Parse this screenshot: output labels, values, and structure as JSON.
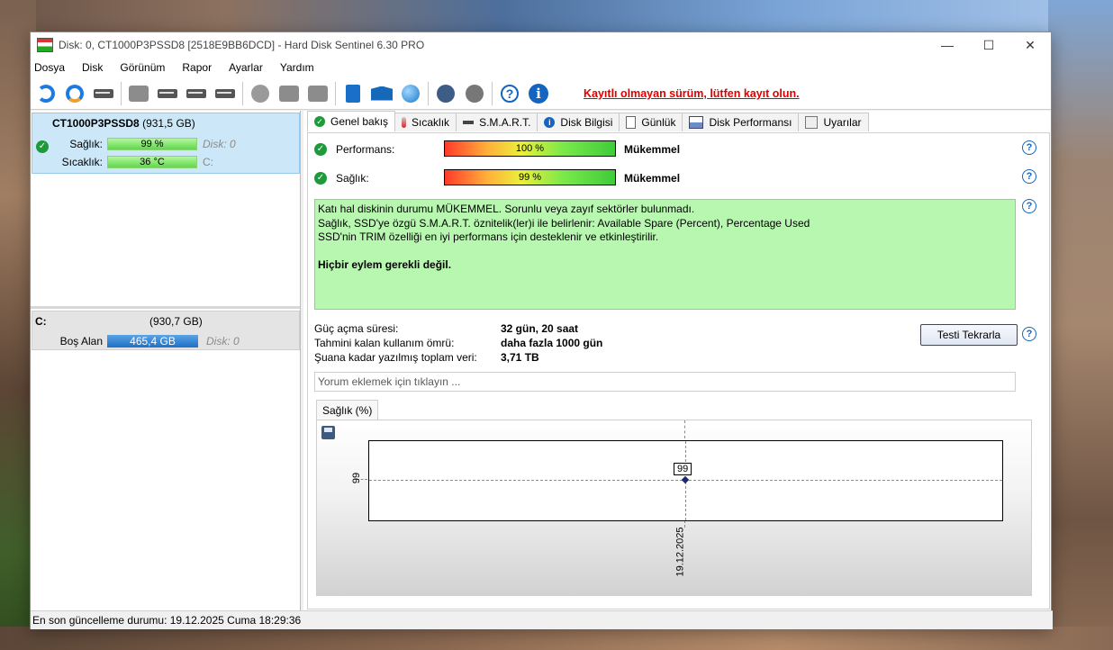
{
  "window": {
    "title": "Disk: 0, CT1000P3PSSD8 [2518E9BB6DCD]  -  Hard Disk Sentinel 6.30 PRO",
    "minimize": "—",
    "maximize": "☐",
    "close": "✕"
  },
  "menu": [
    {
      "label": "Dosya"
    },
    {
      "label": "Disk"
    },
    {
      "label": "Görünüm"
    },
    {
      "label": "Rapor"
    },
    {
      "label": "Ayarlar"
    },
    {
      "label": "Yardım"
    }
  ],
  "toolbar": {
    "nag": "Kayıtlı olmayan sürüm, lütfen kayıt olun.",
    "help": "?",
    "info": "i"
  },
  "disk_card": {
    "name": "CT1000P3PSSD8",
    "size": "(931,5 GB)",
    "health_label": "Sağlık:",
    "health_value": "99 %",
    "health_fraction": 0.99,
    "disk_index": "Disk: 0",
    "temp_label": "Sıcaklık:",
    "temp_value": "36 °C",
    "drive": "C:"
  },
  "volume": {
    "letter": "C:",
    "size": "(930,7 GB)",
    "free_label": "Boş Alan",
    "free_value": "465,4 GB",
    "disk_index": "Disk: 0"
  },
  "tabs": [
    {
      "label": "Genel bakış",
      "icon": "check-icon",
      "active": true
    },
    {
      "label": "Sıcaklık",
      "icon": "thermometer-icon"
    },
    {
      "label": "S.M.A.R.T.",
      "icon": "disk-icon"
    },
    {
      "label": "Disk Bilgisi",
      "icon": "info-icon"
    },
    {
      "label": "Günlük",
      "icon": "log-icon"
    },
    {
      "label": "Disk Performansı",
      "icon": "performance-icon"
    },
    {
      "label": "Uyarılar",
      "icon": "alerts-icon"
    }
  ],
  "overview": {
    "performance_label": "Performans:",
    "performance_value": "100 %",
    "performance_rating": "Mükemmel",
    "health_label": "Sağlık:",
    "health_value": "99 %",
    "health_rating": "Mükemmel",
    "message_lines": [
      "Katı hal diskinin durumu MÜKEMMEL. Sorunlu veya zayıf sektörler bulunmadı.",
      "Sağlık, SSD'ye özgü S.M.A.R.T. öznitelik(ler)i ile belirlenir:  Available Spare (Percent), Percentage Used",
      "SSD'nin TRIM özelliği en iyi performans için desteklenir ve etkinleştirilir."
    ],
    "message_action": "Hiçbir eylem gerekli değil.",
    "power_on_label": "Güç açma süresi:",
    "power_on_value": "32 gün, 20 saat",
    "lifetime_label": "Tahmini kalan kullanım ömrü:",
    "lifetime_value": "daha fazla 1000 gün",
    "written_label": "Şuana kadar yazılmış toplam veri:",
    "written_value": "3,71 TB",
    "retest_button": "Testi Tekrarla",
    "comment_placeholder": "Yorum eklemek için tıklayın ..."
  },
  "graph_tab": "Sağlık (%)",
  "chart_data": {
    "type": "line",
    "x": [
      "19.12.2025"
    ],
    "series": [
      {
        "values": [
          99
        ]
      }
    ],
    "y_tick": "99",
    "point_label": "99",
    "x_tick": "19.12.2025",
    "grid": true
  },
  "status": "En son güncelleme durumu: 19.12.2025 Cuma 18:29:36",
  "colors": {
    "healthy_green": "#b8f7b0",
    "nag_red": "#e00000",
    "selection_blue": "#cce8f8",
    "free_space_blue": "#1f6fc4"
  }
}
